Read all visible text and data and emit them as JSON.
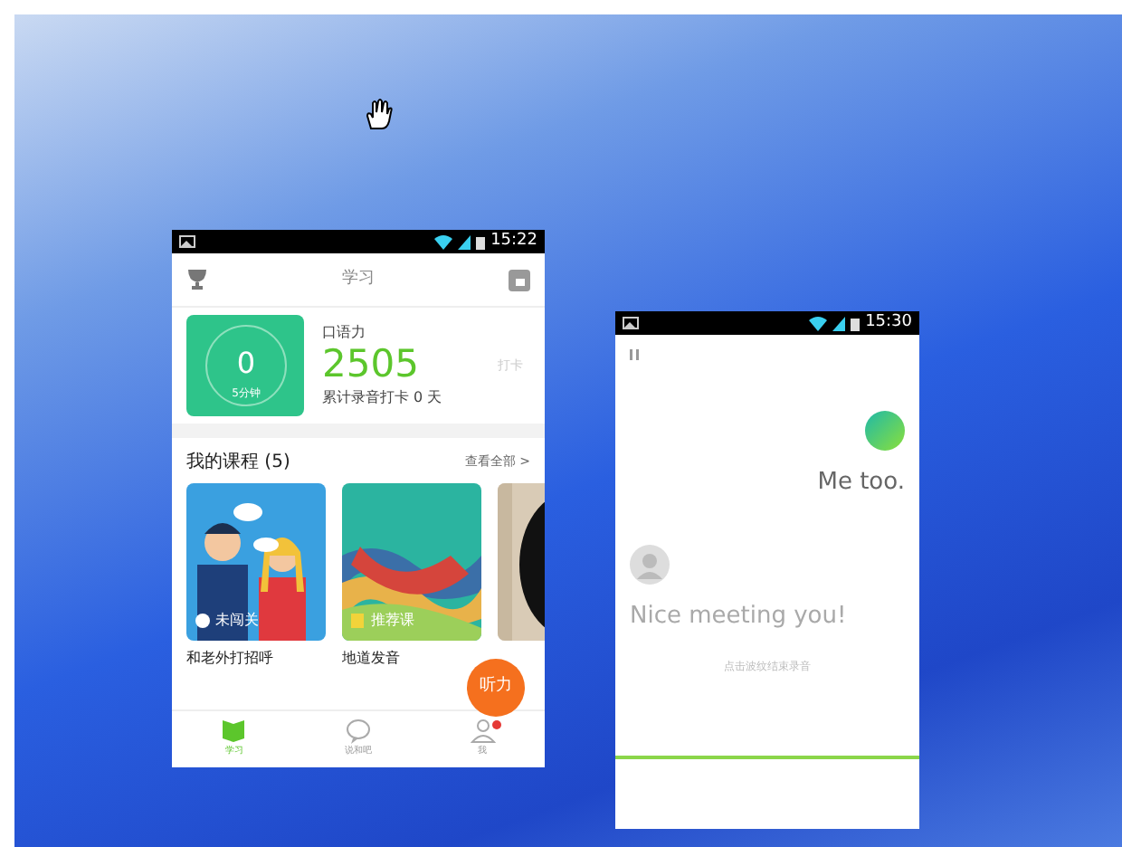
{
  "phone_1": {
    "status_bar": {
      "time": "15:22"
    },
    "header": {
      "title": "学习"
    },
    "stats": {
      "ring_value": "0",
      "ring_caption": "5分钟",
      "label": "口语力",
      "score": "2505",
      "checkin_button": "打卡",
      "summary": "累计录音打卡 0 天"
    },
    "courses": {
      "title": "我的课程 (5)",
      "see_all": "查看全部 >",
      "items": [
        {
          "kind": "course",
          "badge": "未闯关",
          "title": "和老外打招呼"
        },
        {
          "kind": "course",
          "badge": "推荐课",
          "title": "地道发音"
        },
        {
          "kind": "picture"
        }
      ]
    },
    "fab": "听力",
    "nav": [
      {
        "label": "学习",
        "selected": true,
        "notification": false
      },
      {
        "label": "说和吧",
        "selected": false,
        "notification": false
      },
      {
        "label": "我",
        "selected": false,
        "notification": true
      }
    ]
  },
  "phone_2": {
    "status_bar": {
      "time": "15:30"
    },
    "messages": [
      {
        "kind": "reply",
        "text": "Me too.",
        "faded": false
      },
      {
        "kind": "prompt",
        "text": "Nice meeting you!",
        "faded": true
      }
    ],
    "hint": "点击波纹结束录音"
  }
}
